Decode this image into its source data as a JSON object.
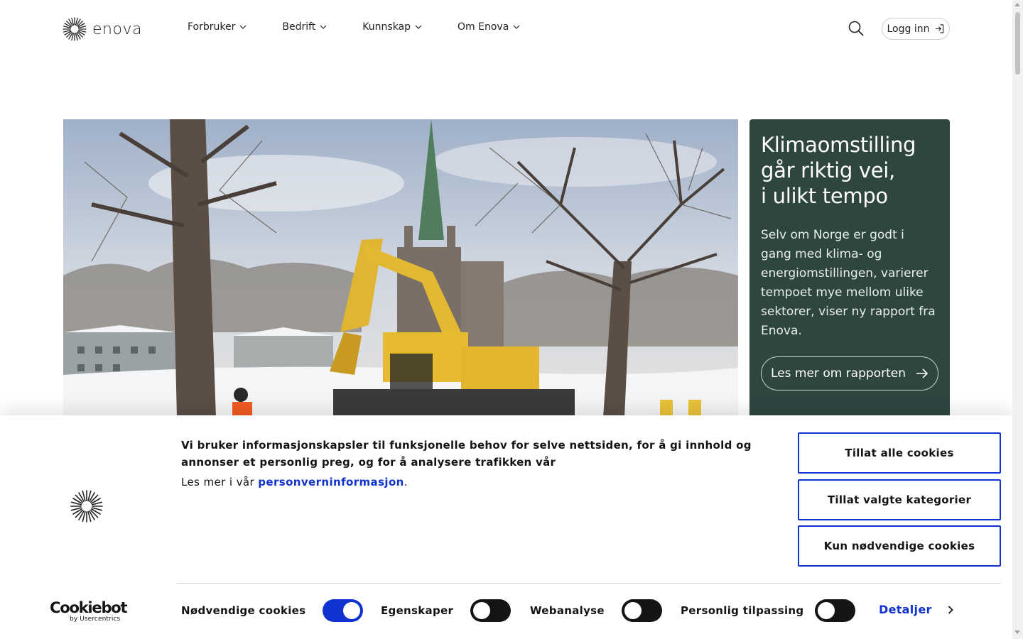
{
  "header": {
    "logo_text": "enova",
    "nav": [
      {
        "label": "Forbruker"
      },
      {
        "label": "Bedrift"
      },
      {
        "label": "Kunnskap"
      },
      {
        "label": "Om Enova"
      }
    ],
    "login_label": "Logg inn"
  },
  "feature": {
    "title_lines": [
      "Klimaomstilling",
      "går riktig vei,",
      "i ulikt tempo"
    ],
    "text": "Selv om Norge er godt i gang med klima- og energiomstillingen, varierer tempoet mye mellom ulike sektorer, viser ny rapport fra Enova.",
    "button_label": "Les mer om rapporten",
    "background": "#2f4540"
  },
  "cookie": {
    "title": "Vi bruker informasjonskapsler til funksjonelle behov for selve nettsiden, for å gi innhold og annonser et personlig preg, og for å analysere trafikken vår",
    "more_prefix": "Les mer i vår ",
    "more_link": "personverninformasjon",
    "more_suffix": ".",
    "buttons": [
      "Tillat alle cookies",
      "Tillat valgte kategorier",
      "Kun nødvendige cookies"
    ],
    "toggles": [
      {
        "label": "Nødvendige cookies",
        "on": true
      },
      {
        "label": "Egenskaper",
        "on": false
      },
      {
        "label": "Webanalyse",
        "on": false
      },
      {
        "label": "Personlig tilpassing",
        "on": false
      }
    ],
    "details_label": "Detaljer",
    "brand_main": "Cookiebot",
    "brand_sub": "by Usercentrics",
    "accent": "#1032cf"
  }
}
